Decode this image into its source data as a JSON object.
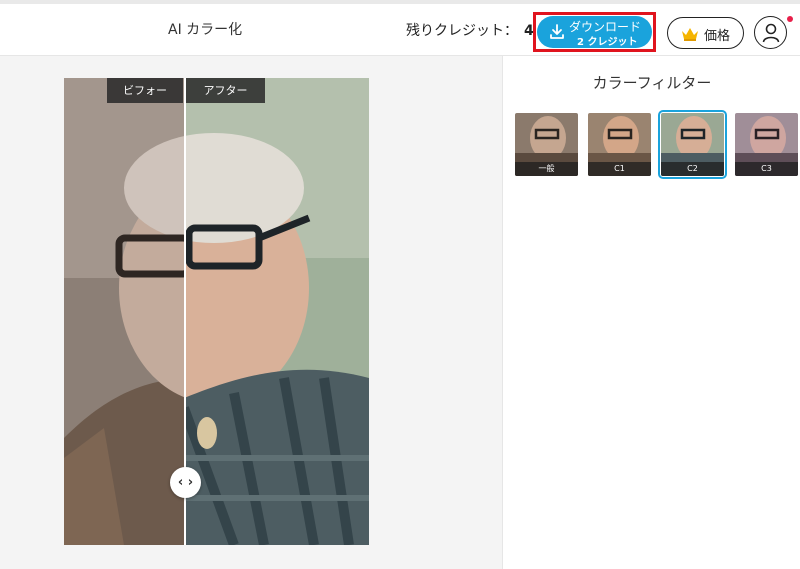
{
  "header": {
    "title": "AI カラー化",
    "credits_label": "残りクレジット：",
    "credits_value": "4",
    "download_label": "ダウンロード",
    "download_sub": "2 クレジット",
    "price_label": "価格"
  },
  "compare": {
    "before_label": "ビフォー",
    "after_label": "アフター"
  },
  "panel": {
    "title": "カラーフィルター",
    "filters": [
      {
        "label": "一般",
        "selected": false
      },
      {
        "label": "C1",
        "selected": false
      },
      {
        "label": "C2",
        "selected": true
      },
      {
        "label": "C3",
        "selected": false
      }
    ]
  },
  "icons": {
    "download": "download-icon",
    "crown": "crown-icon",
    "user": "user-icon",
    "handle": "compare-handle-icon"
  },
  "colors": {
    "accent": "#1aa3dc",
    "highlight": "#e0141e",
    "notification": "#e81f4a"
  }
}
